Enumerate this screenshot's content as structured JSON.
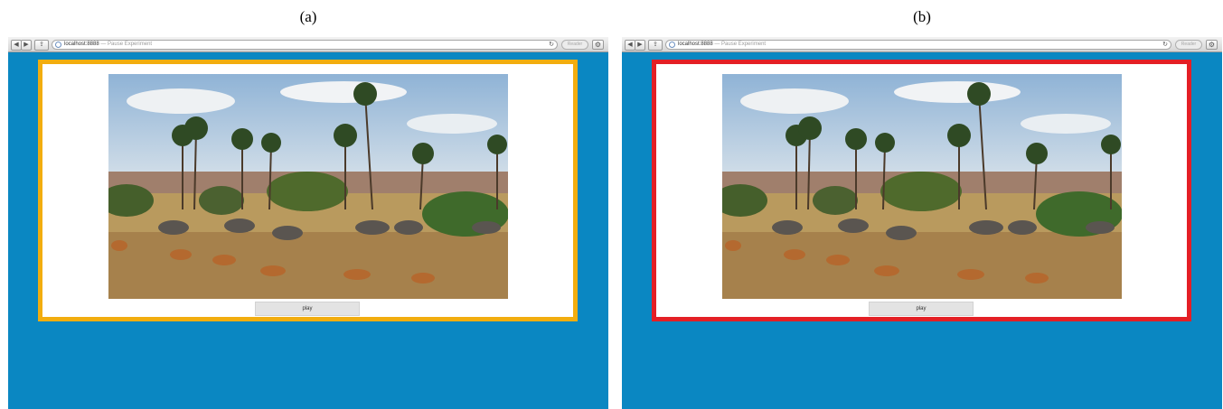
{
  "panels": [
    {
      "caption": "(a)",
      "browser": {
        "url": "localhost:8888",
        "page_title": "— Pause Experiment",
        "reader_label": "Reader",
        "icons": [
          "back-icon",
          "forward-icon",
          "share-icon",
          "globe-icon",
          "reload-icon",
          "gear-icon"
        ]
      },
      "frame_color": "#f2ad0f",
      "play_label": "play"
    },
    {
      "caption": "(b)",
      "browser": {
        "url": "localhost:8888",
        "page_title": "— Pause Experiment",
        "reader_label": "Reader",
        "icons": [
          "back-icon",
          "forward-icon",
          "share-icon",
          "globe-icon",
          "reload-icon",
          "gear-icon"
        ]
      },
      "frame_color": "#e41f25",
      "play_label": "play"
    }
  ],
  "colors": {
    "page_background": "#0a87c2",
    "frame_border_a": "#f2ad0f",
    "frame_border_b": "#e41f25"
  }
}
